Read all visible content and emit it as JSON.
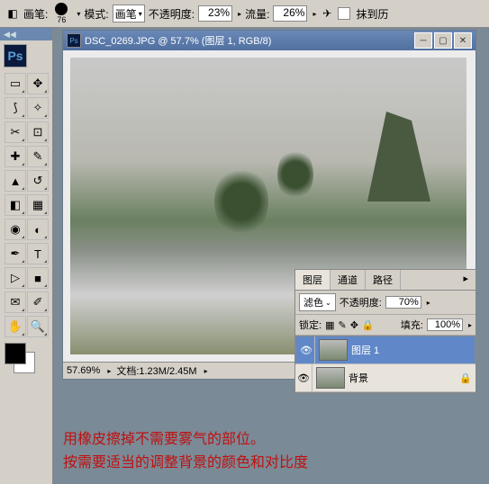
{
  "optbar": {
    "brush_label": "画笔:",
    "brush_size": "76",
    "mode_label": "模式:",
    "mode_value": "画笔",
    "opacity_label": "不透明度:",
    "opacity_value": "23%",
    "flow_label": "流量:",
    "flow_value": "26%",
    "history_label": "抹到历"
  },
  "doc": {
    "title": "DSC_0269.JPG @ 57.7% (图层 1, RGB/8)",
    "zoom": "57.69%",
    "docinfo": "文档:1.23M/2.45M"
  },
  "layers": {
    "tabs": [
      "图层",
      "通道",
      "路径"
    ],
    "blend_label": "滤色",
    "opacity_label": "不透明度:",
    "opacity_value": "70%",
    "lock_label": "锁定:",
    "fill_label": "填充:",
    "fill_value": "100%",
    "items": [
      {
        "name": "图层 1",
        "locked": false
      },
      {
        "name": "背景",
        "locked": true
      }
    ]
  },
  "captions": {
    "line1": "用橡皮擦掉不需要雾气的部位。",
    "line2": "按需要适当的调整背景的颜色和对比度"
  },
  "icons": {
    "marquee": "▭",
    "move": "✥",
    "lasso": "⟆",
    "wand": "✧",
    "crop": "✂",
    "slice": "⊡",
    "heal": "✚",
    "brush": "✎",
    "stamp": "▲",
    "history": "↺",
    "eraser": "◧",
    "grad": "▦",
    "blur": "◉",
    "dodge": "◐",
    "pen": "✒",
    "type": "T",
    "path": "▷",
    "shape": "■",
    "notes": "✉",
    "eyedrop": "✐",
    "hand": "✋",
    "zoom": "🔍"
  }
}
